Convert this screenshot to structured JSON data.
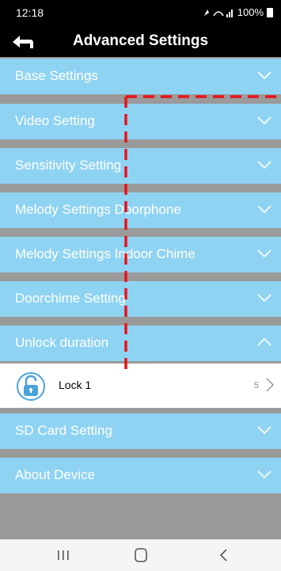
{
  "status": {
    "time": "12:18",
    "battery": "100%"
  },
  "header": {
    "title": "Advanced Settings"
  },
  "menu": [
    "Base Settings",
    "Video Setting",
    "Sensitivity Setting",
    "Melody Settings Doorphone",
    "Melody Settings Indoor Chime",
    "Doorchime Setting",
    "Unlock duration",
    "SD Card Setting",
    "About Device"
  ],
  "unlock": {
    "lock_label": "Lock 1",
    "lock_value": "5"
  },
  "icons": {
    "back": "back-arrow-icon",
    "expand": "chevron-down-icon",
    "collapse": "chevron-up-icon",
    "lock": "unlock-padlock-icon",
    "nav": [
      "recent-apps-icon",
      "home-icon",
      "back-icon"
    ]
  },
  "colors": {
    "item_bg": "#8fd3f3",
    "annotation": "#e8131b"
  }
}
